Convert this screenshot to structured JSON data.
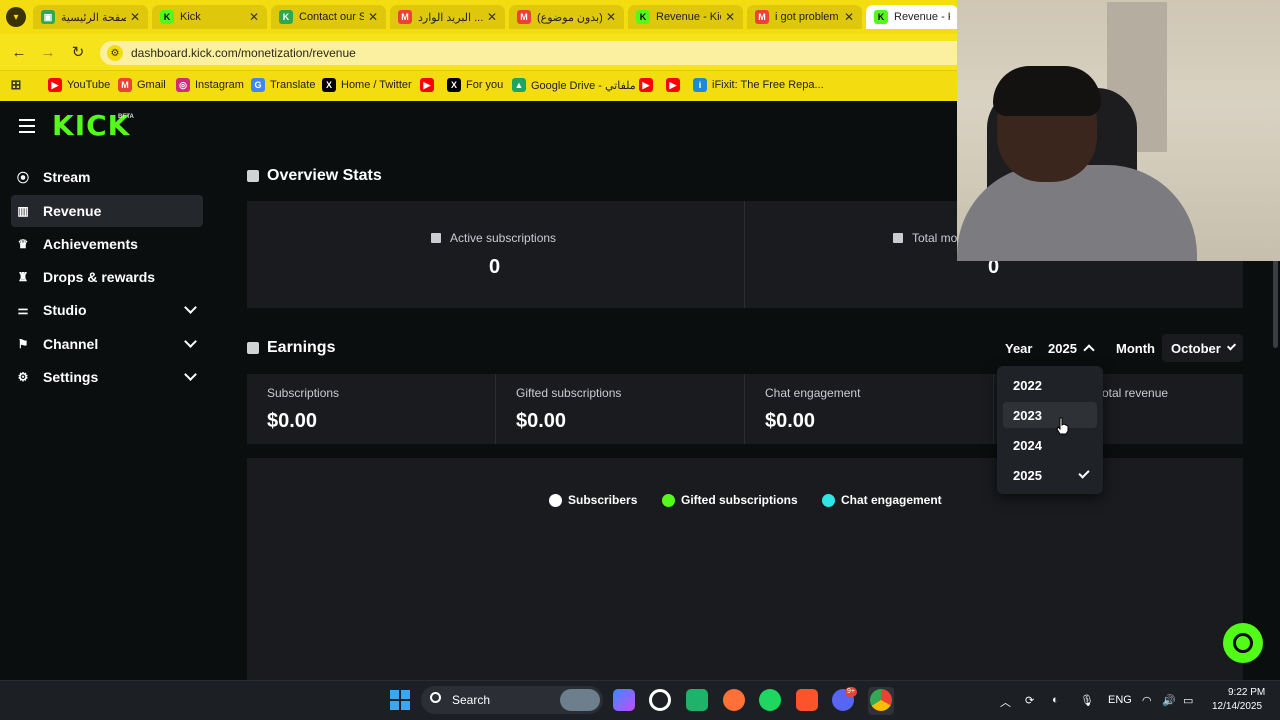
{
  "browser": {
    "tabs": [
      {
        "title": "الصفحة الرئيسية",
        "favicon": "site-icon",
        "color": "#2fa84f"
      },
      {
        "title": "Kick",
        "favicon": "kick-icon",
        "color": "#53fc18"
      },
      {
        "title": "Contact our S",
        "favicon": "kick-icon",
        "color": "#53fc18"
      },
      {
        "title": "البريد الوارد ...",
        "favicon": "gmail-icon",
        "color": "#ea4335"
      },
      {
        "title": "(بدون موضوع)",
        "favicon": "gmail-icon",
        "color": "#ea4335"
      },
      {
        "title": "Revenue - Kick",
        "favicon": "kick-icon",
        "color": "#53fc18"
      },
      {
        "title": "i got problem",
        "favicon": "gmail-icon",
        "color": "#ea4335"
      },
      {
        "title": "Revenue - Kick",
        "favicon": "kick-icon",
        "color": "#53fc18"
      }
    ],
    "url": "dashboard.kick.com/monetization/revenue",
    "bookmarks": [
      {
        "label": "",
        "icon": "apps-grid-icon"
      },
      {
        "label": "YouTube",
        "icon": "youtube-icon"
      },
      {
        "label": "Gmail",
        "icon": "gmail-icon"
      },
      {
        "label": "Instagram",
        "icon": "instagram-icon"
      },
      {
        "label": "Translate",
        "icon": "translate-icon"
      },
      {
        "label": "Home / Twitter",
        "icon": "x-icon"
      },
      {
        "label": "",
        "icon": "youtube-icon"
      },
      {
        "label": "For you",
        "icon": "x-icon"
      },
      {
        "label": "Google Drive - ملفاتي",
        "icon": "drive-icon"
      },
      {
        "label": "",
        "icon": "youtube-icon"
      },
      {
        "label": "",
        "icon": "youtube-icon"
      },
      {
        "label": "iFixit: The Free Repa...",
        "icon": "ifixit-icon"
      }
    ]
  },
  "kick": {
    "logo": "KICK",
    "logo_badge": "BETA",
    "sidebar": [
      {
        "label": "Stream",
        "icon": "broadcast-icon"
      },
      {
        "label": "Revenue",
        "icon": "chart-icon",
        "selected": true
      },
      {
        "label": "Achievements",
        "icon": "trophy-icon"
      },
      {
        "label": "Drops & rewards",
        "icon": "gift-icon"
      },
      {
        "label": "Studio",
        "icon": "sliders-icon",
        "expandable": true
      },
      {
        "label": "Channel",
        "icon": "flag-icon",
        "expandable": true
      },
      {
        "label": "Settings",
        "icon": "gear-icon",
        "expandable": true
      }
    ],
    "overview": {
      "title": "Overview Stats",
      "active_subscriptions_label": "Active subscriptions",
      "active_subscriptions_value": "0",
      "total_label": "Total mo",
      "total_value": "0"
    },
    "earnings": {
      "title": "Earnings",
      "year_label": "Year",
      "year_value": "2025",
      "month_label": "Month",
      "month_value": "October",
      "cards": [
        {
          "label": "Subscriptions",
          "value": "$0.00"
        },
        {
          "label": "Gifted subscriptions",
          "value": "$0.00"
        },
        {
          "label": "Chat engagement",
          "value": "$0.00"
        },
        {
          "label": "otal revenue",
          "value": ""
        }
      ],
      "year_options": [
        {
          "label": "2022"
        },
        {
          "label": "2023",
          "hovered": true
        },
        {
          "label": "2024"
        },
        {
          "label": "2025",
          "checked": true
        }
      ],
      "legend": [
        {
          "label": "Subscribers",
          "color": "#ffffff"
        },
        {
          "label": "Gifted subscriptions",
          "color": "#53fc18"
        },
        {
          "label": "Chat engagement",
          "color": "#2ee6e6"
        }
      ]
    }
  },
  "taskbar": {
    "search_label": "Search",
    "language": "ENG",
    "time": "9:22 PM",
    "date": "12/14/2025",
    "discord_badge": "9+"
  }
}
